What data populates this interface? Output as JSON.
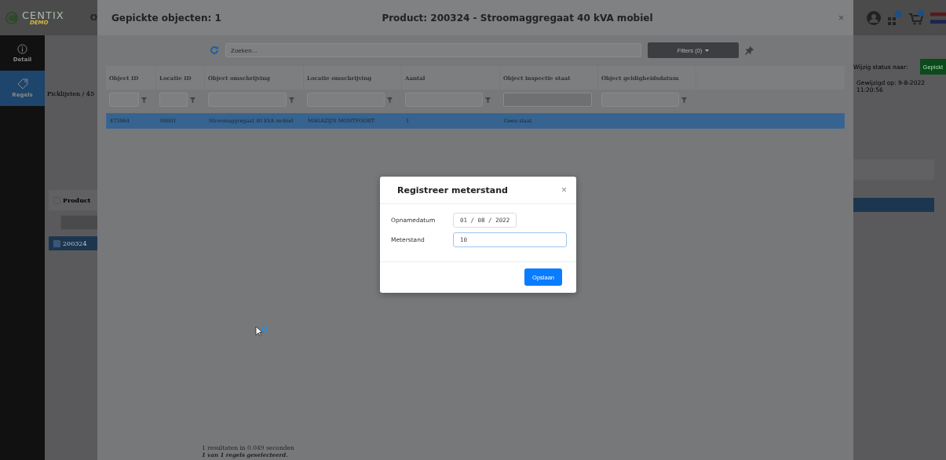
{
  "app": {
    "logo": {
      "name": "CENTIX",
      "sub": "DEMO"
    },
    "header_text": "O"
  },
  "sidebar": [
    {
      "label": "Detail",
      "kind": "info",
      "selected": false
    },
    {
      "label": "Regels",
      "kind": "tag",
      "selected": true
    }
  ],
  "breadcrumb": "Picklijsten / 45",
  "lines_header": {
    "label": "Product",
    "checked": false
  },
  "lines": [
    {
      "label": "200324",
      "checked": true,
      "selected": true
    }
  ],
  "status": {
    "label": "Wijzig status naar:",
    "button": "Gepickt",
    "modified": "Gewijzigd op: 9-8-2022 11:20:56"
  },
  "panel": {
    "title": "Gepickte objecten: 1",
    "product": "Product: 200324 - Stroomaggregaat 40 kVA mobiel",
    "close": "×",
    "search": {
      "placeholder": "Zoeken..."
    },
    "filters_button": "Filters (0)",
    "columns": [
      {
        "label": "Object ID",
        "filter_disabled": false
      },
      {
        "label": "Locatie ID",
        "filter_disabled": false
      },
      {
        "label": "Object omschrijving",
        "filter_disabled": false
      },
      {
        "label": "Locatie omschrijving",
        "filter_disabled": false
      },
      {
        "label": "Aantal",
        "filter_disabled": false
      },
      {
        "label": "Object inspectie staat",
        "filter_disabled": true
      },
      {
        "label": "Object geldigheidsdatum",
        "filter_disabled": false
      }
    ],
    "rows": [
      {
        "selected": true,
        "cells": [
          "473964",
          "00001",
          "Stroomaggregaat 40 kVA mobiel",
          "MAGAZIJN MONTFOORT",
          "1",
          "Geen staat",
          ""
        ]
      }
    ],
    "results": "1 resultaten in 0.049 seconden",
    "selection": "1 van 1 regels geselecteerd."
  },
  "dialog": {
    "title": "Registreer meterstand",
    "close": "×",
    "fields": [
      {
        "label": "Opnamedatum",
        "kind": "date",
        "value": "01 / 08 / 2022"
      },
      {
        "label": "Meterstand",
        "kind": "number",
        "value": "10"
      }
    ],
    "button": "Opslaan"
  }
}
